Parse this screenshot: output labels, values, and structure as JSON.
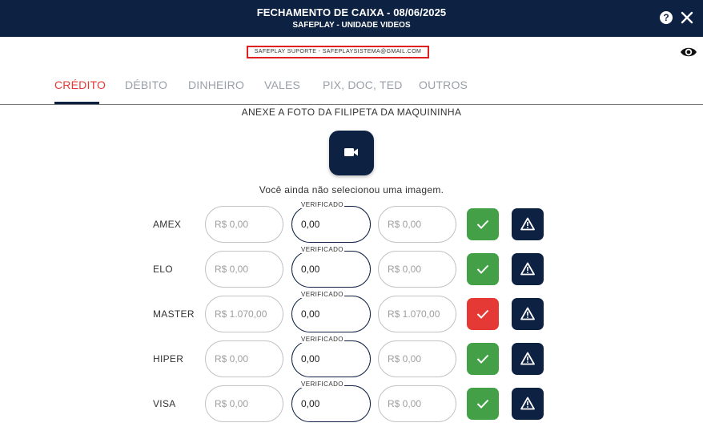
{
  "header": {
    "title": "FECHAMENTO DE CAIXA - 08/06/2025",
    "subtitle": "SAFEPLAY - UNIDADE VIDEOS",
    "help_icon": "help-circle-icon",
    "help_label": "?",
    "close_icon": "close-icon"
  },
  "support": {
    "text": "SAFEPLAY SUPORTE - SAFEPLAYSISTEMA@GMAIL.COM",
    "eye_icon": "eye-icon"
  },
  "tabs": [
    {
      "label": "CRÉDITO",
      "active": true
    },
    {
      "label": "DÉBITO",
      "active": false
    },
    {
      "label": "DINHEIRO",
      "active": false
    },
    {
      "label": "VALES",
      "active": false
    },
    {
      "label": "PIX, DOC, TED",
      "active": false
    },
    {
      "label": "OUTROS",
      "active": false
    }
  ],
  "upload": {
    "instruction": "ANEXE A FOTO DA FILIPETA DA MAQUININHA",
    "camera_icon": "video-camera-icon",
    "no_image_text": "Você ainda não selecionou uma imagem."
  },
  "verified_legend": "VERIFICADO",
  "rows": [
    {
      "label": "AMEX",
      "reported": "R$ 0,00",
      "verified": "0,00",
      "difference": "R$ 0,00",
      "status": "ok"
    },
    {
      "label": "ELO",
      "reported": "R$ 0,00",
      "verified": "0,00",
      "difference": "R$ 0,00",
      "status": "ok"
    },
    {
      "label": "MASTER",
      "reported": "R$ 1.070,00",
      "verified": "0,00",
      "difference": "R$ 1.070,00",
      "status": "error"
    },
    {
      "label": "HIPER",
      "reported": "R$ 0,00",
      "verified": "0,00",
      "difference": "R$ 0,00",
      "status": "ok"
    },
    {
      "label": "VISA",
      "reported": "R$ 0,00",
      "verified": "0,00",
      "difference": "R$ 0,00",
      "status": "ok"
    }
  ],
  "colors": {
    "primary": "#0d2142",
    "accent": "#e53935",
    "success": "#43a047"
  }
}
